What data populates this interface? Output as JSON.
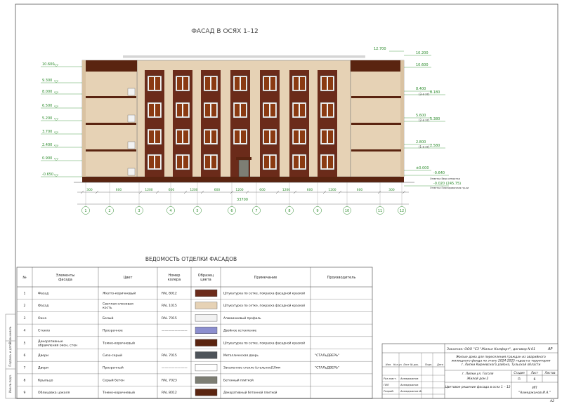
{
  "facade": {
    "title": "ФАСАД В ОСЯХ 1–12",
    "left_marks": [
      "10.600",
      "9.300",
      "8.000",
      "6.500",
      "5.200",
      "3.700",
      "2.400",
      "0.900",
      "-0.650"
    ],
    "right_marks": [
      "12.700",
      "10.200",
      "10.600",
      "8.400",
      "8.180",
      "5.600",
      "5.380",
      "2.800",
      "2.580",
      "±0.000",
      "-0.640",
      "-0.020 (245.75)"
    ],
    "floor_tags": [
      "(3-я эт)",
      "(2-я эт)",
      "(1-я эт)"
    ],
    "ground_notes": [
      "Отметка Верх отмостки",
      "Отметка Планировочная пр-ки"
    ],
    "dims": [
      "300",
      "600",
      "1200",
      "600",
      "1200",
      "600",
      "1200",
      "600",
      "1200",
      "600",
      "1200",
      "600",
      "300"
    ],
    "total_dim": "33700",
    "axes": [
      "1",
      "2",
      "3",
      "4",
      "5",
      "6",
      "7",
      "8",
      "9",
      "10",
      "11",
      "12"
    ]
  },
  "schedule": {
    "title": "ВЕДОМОСТЬ ОТДЕЛКИ ФАСАДОВ",
    "headers": [
      "№",
      "Элементы фасада",
      "Цвет",
      "Номер колера",
      "Образец цвета",
      "Примечание",
      "Производитель"
    ],
    "rows": [
      {
        "n": "1",
        "el": "Фасад",
        "color": "Желто-коричневый",
        "code": "RAL 8012",
        "swatch": "#6b2b1a",
        "note": "Штукатурка по сетке, покраска фасадной краской",
        "maker": ""
      },
      {
        "n": "2",
        "el": "Фасад",
        "color": "Светлая слоновая кость",
        "code": "RAL 1015",
        "swatch": "#e6d2b5",
        "note": "Штукатурка по сетке, покраска фасадной краской",
        "maker": ""
      },
      {
        "n": "3",
        "el": "Окна",
        "color": "Белый",
        "code": "RAL 7015",
        "swatch": "#f2f2f2",
        "note": "Алюминиевый профиль",
        "maker": ""
      },
      {
        "n": "4",
        "el": "Стекло",
        "color": "Прозрачное",
        "code": "————————",
        "swatch": "#8c8fcf",
        "note": "Двойное остекление",
        "maker": ""
      },
      {
        "n": "5",
        "el": "Декоративные обрамления окон, стен",
        "color": "Темно-коричневый",
        "code": "",
        "swatch": "#5a2410",
        "note": "Штукатурка по сетке, покраска фасадной краской",
        "maker": ""
      },
      {
        "n": "6",
        "el": "Двери",
        "color": "Сизо-серый",
        "code": "RAL 7015",
        "swatch": "#4e545a",
        "note": "Металлическая дверь",
        "maker": "\"СТАЛьДВЕРЬ\""
      },
      {
        "n": "7",
        "el": "Двери",
        "color": "Прозрачный",
        "code": "————————",
        "swatch": "#ffffff",
        "note": "Закаленное стекло (стальное)10мм",
        "maker": "\"СТАЛьДВЕРЬ\""
      },
      {
        "n": "8",
        "el": "Крыльцо",
        "color": "Серый бетон",
        "code": "RAL 7023",
        "swatch": "#7d7e74",
        "note": "Бетонный плиткой",
        "maker": ""
      },
      {
        "n": "9",
        "el": "Облицовка цоколя",
        "color": "Темно-коричневый",
        "code": "RAL 8012",
        "swatch": "#5a2410",
        "note": "Декоративный бетонной плиткой",
        "maker": ""
      }
    ]
  },
  "stamp": {
    "customer": "Заказчик: ООО \"СЗ \"Жилье Комфорт\", договор N 01",
    "code": "АР",
    "project": "Жилые дома для переселения граждан из аварийного жилищного фонда по этапу 2024-2025 годов на территории г. Липки Киреевского района, Тульской области",
    "address": "г. Липки ул. Гоголя",
    "building": "Жилой дом 2",
    "sheet_title": "Цветовое решение фасада в осях 1 – 12",
    "col_heads": [
      "Изм.",
      "Кол.уч",
      "Лист",
      "№ док.",
      "Подп.",
      "Дата"
    ],
    "people": [
      {
        "role": "Рук.маст.",
        "name": "Ахмеджанов"
      },
      {
        "role": "ГИП",
        "name": "Ахмеджанов"
      },
      {
        "role": "Разраб.",
        "name": "Ахмеджанов Ф."
      }
    ],
    "stage_head": "Стадия",
    "sheet_head": "Лист",
    "sheets_head": "Листов",
    "stage": "П",
    "sheet_no": "6",
    "org_1": "ИП",
    "org_2": "\"Ахмеджанов И.А.\"",
    "format": "А2"
  },
  "side_strip": [
    "Инв.№ подл.",
    "Подпись и дата",
    "Взам.инв.№"
  ]
}
